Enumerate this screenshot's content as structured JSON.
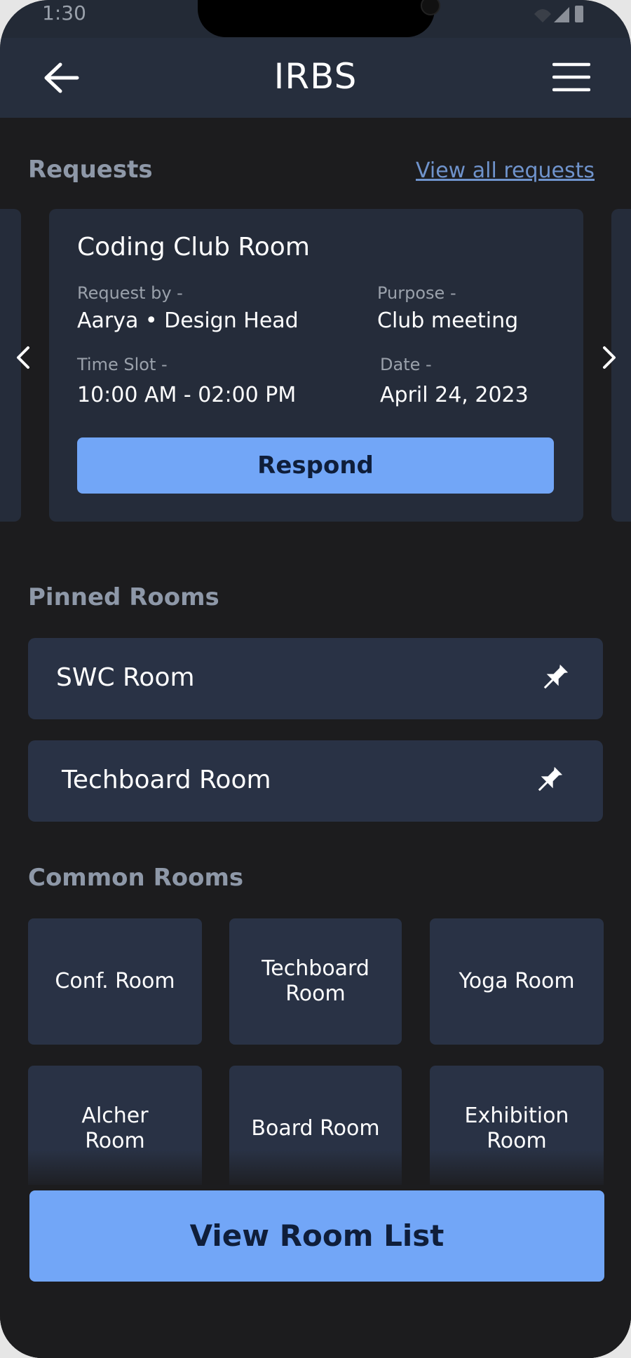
{
  "status_bar": {
    "time": "1:30"
  },
  "app_bar": {
    "title": "IRBS"
  },
  "requests": {
    "heading": "Requests",
    "view_all": "View all requests",
    "card": {
      "room": "Coding Club Room",
      "request_by_label": "Request by -",
      "request_by_value": "Aarya • Design Head",
      "purpose_label": "Purpose -",
      "purpose_value": "Club meeting",
      "time_slot_label": "Time Slot -",
      "time_slot_value": "10:00 AM - 02:00 PM",
      "date_label": "Date -",
      "date_value": "April 24, 2023",
      "respond_label": "Respond"
    }
  },
  "pinned": {
    "heading": "Pinned Rooms",
    "items": [
      {
        "label": "SWC Room",
        "icon": "pin-icon"
      },
      {
        "label": "Techboard Room",
        "icon": "pin-icon"
      }
    ]
  },
  "common": {
    "heading": "Common Rooms",
    "rooms": [
      "Conf. Room",
      "Techboard Room",
      "Yoga Room",
      "Alcher Room",
      "Board Room",
      "Exhibition Room"
    ]
  },
  "footer": {
    "view_room_list": "View Room List"
  },
  "colors": {
    "background": "#1c1c1e",
    "card": "#252c3a",
    "accent": "#72a6f7",
    "link": "#6f93cc",
    "muted": "#8e98a8"
  }
}
